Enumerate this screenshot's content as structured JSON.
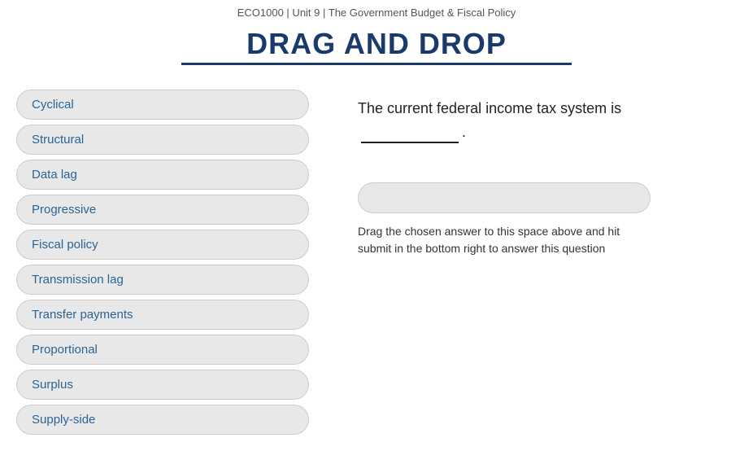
{
  "breadcrumb": "ECO1000 | Unit 9 | The Government Budget & Fiscal Policy",
  "title": "DRAG AND DROP",
  "drag_items": [
    {
      "id": "cyclical",
      "label": "Cyclical"
    },
    {
      "id": "structural",
      "label": "Structural"
    },
    {
      "id": "data-lag",
      "label": "Data lag"
    },
    {
      "id": "progressive",
      "label": "Progressive"
    },
    {
      "id": "fiscal-policy",
      "label": "Fiscal policy"
    },
    {
      "id": "transmission-lag",
      "label": "Transmission lag"
    },
    {
      "id": "transfer-payments",
      "label": "Transfer payments"
    },
    {
      "id": "proportional",
      "label": "Proportional"
    },
    {
      "id": "surplus",
      "label": "Surplus"
    },
    {
      "id": "supply-side",
      "label": "Supply-side"
    }
  ],
  "question": {
    "text_before": "The current federal income tax system is",
    "text_after": ".",
    "drop_hint": "Drag the chosen answer to this space above and hit submit in the bottom right to answer this question"
  }
}
